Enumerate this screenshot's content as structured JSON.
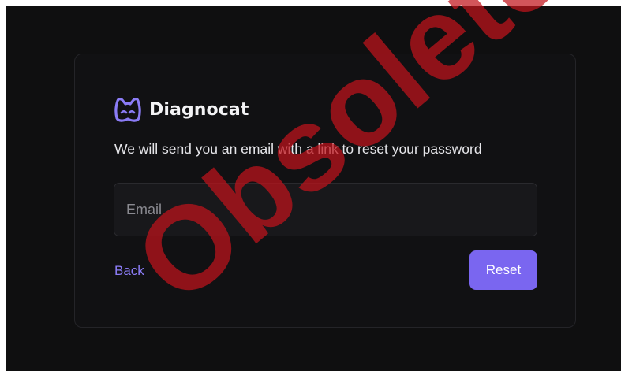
{
  "brand": {
    "name": "Diagnocat",
    "logo_icon": "cat-mask-logo-icon",
    "logo_color": "#8b7cf6"
  },
  "form": {
    "subtitle": "We will send you an email with a link to reset your password",
    "email_placeholder": "Email",
    "email_value": "",
    "back_label": "Back",
    "reset_label": "Reset"
  },
  "watermark": {
    "text": "Obsolete",
    "color": "#c0141c"
  },
  "colors": {
    "background": "#0f0f10",
    "card": "#111113",
    "accent": "#7a66f0",
    "link": "#8b7cf6"
  }
}
